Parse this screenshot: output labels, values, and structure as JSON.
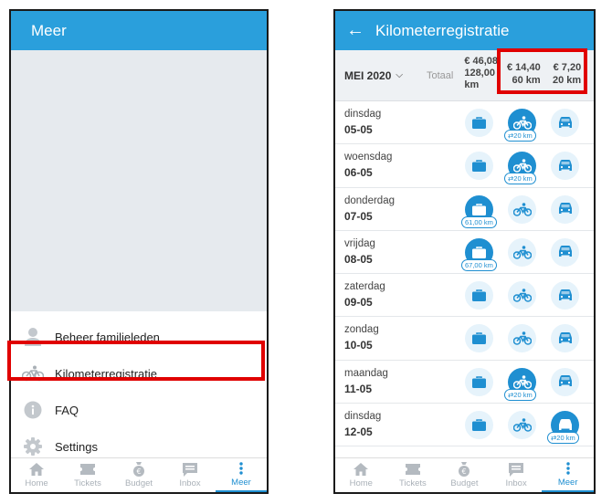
{
  "left": {
    "title": "Meer",
    "menu": [
      {
        "label": "Beheer familieleden",
        "icon": "person-icon"
      },
      {
        "label": "Kilometerregistratie",
        "icon": "bicycle-icon"
      },
      {
        "label": "FAQ",
        "icon": "info-icon"
      },
      {
        "label": "Settings",
        "icon": "gear-icon"
      }
    ]
  },
  "right": {
    "title": "Kilometerregistratie",
    "month": "MEI 2020",
    "totaal_label": "Totaal",
    "total_amount": "€ 46,08",
    "total_km_value": "128,00",
    "total_km_unit": "km",
    "col1_amount": "€ 14,40",
    "col1_km": "60 km",
    "col2_amount": "€ 7,20",
    "col2_km": "20 km",
    "days": [
      {
        "name": "dinsdag",
        "date": "05-05",
        "active": "bike",
        "km": "20 km"
      },
      {
        "name": "woensdag",
        "date": "06-05",
        "active": "bike",
        "km": "20 km"
      },
      {
        "name": "donderdag",
        "date": "07-05",
        "active": "briefcase",
        "km": "61,00 km"
      },
      {
        "name": "vrijdag",
        "date": "08-05",
        "active": "briefcase",
        "km": "67,00 km"
      },
      {
        "name": "zaterdag",
        "date": "09-05",
        "active": "",
        "km": ""
      },
      {
        "name": "zondag",
        "date": "10-05",
        "active": "",
        "km": ""
      },
      {
        "name": "maandag",
        "date": "11-05",
        "active": "bike",
        "km": "20 km"
      },
      {
        "name": "dinsdag",
        "date": "12-05",
        "active": "car",
        "km": "20 km"
      }
    ]
  },
  "tabs": [
    "Home",
    "Tickets",
    "Budget",
    "Inbox",
    "Meer"
  ],
  "colors": {
    "accent": "#2a9fdc",
    "active_tab": "#1f8fd1",
    "highlight": "#e00000"
  }
}
